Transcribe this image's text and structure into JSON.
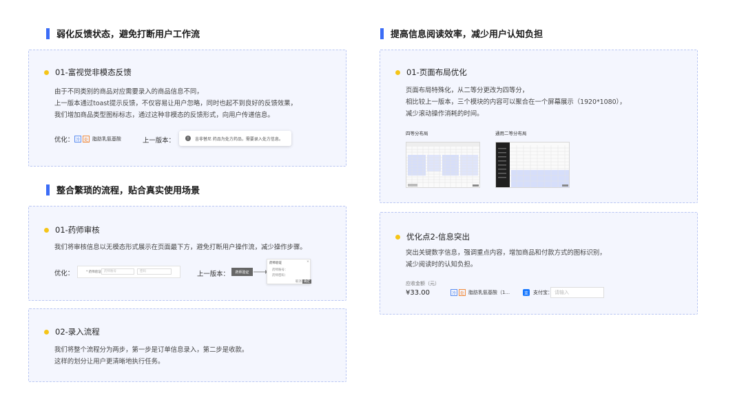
{
  "left": {
    "section1_title": "弱化反馈状态，避免打断用户工作流",
    "card1": {
      "title": "01-富视觉非模态反馈",
      "lines": [
        "由于不同类别的商品对应需要录入的商品信息不同，",
        "上一版本通过toast提示反馈，不仅容易让用户忽略，同时也起不到良好的反馈效果，",
        "我们增加商品类型图标标志，通过这种非模态的反馈形式，向用户传递信息。"
      ],
      "optimize_label": "优化：",
      "tag1": "冷",
      "tag2": "处",
      "drug_name": "脂肪乳氨基酸",
      "prev_label": "上一版本：",
      "toast_icon": "!",
      "toast_text": "吉非替尼 药品为处方药品，需要录入处方信息。"
    },
    "section2_title": "整合繁琐的流程，贴合真实使用场景",
    "card2": {
      "title": "01-药师审核",
      "lines": [
        "我们将审核信息以无模态形式展示在页面最下方，避免打断用户操作流，减少操作步骤。"
      ],
      "optimize_label": "优化：",
      "mini_field_label": "* 药师验证：",
      "mini_field_ph1": "药师账号",
      "mini_field_ph2": "密码",
      "prev_label": "上一版本：",
      "dark_btn": "药师验证",
      "dialog_title": "药师验证",
      "dialog_row1": "药师账号：",
      "dialog_row2": "药师密码：",
      "dialog_btn_cancel": "取消",
      "dialog_btn_ok": "确定"
    },
    "card3": {
      "title": "02-录入流程",
      "lines": [
        "我们将整个流程分为两步，第一步是订单信息录入，第二步是收款。",
        "这样的划分让用户更清晰地执行任务。"
      ]
    }
  },
  "right": {
    "section_title": "提高信息阅读效率，减少用户认知负担",
    "card1": {
      "title": "01-页面布局优化",
      "lines": [
        "页面布局特殊化，从二等分更改为四等分，",
        "相比较上一版本，三个模块的内容可以聚合在一个屏幕展示（1920*1080），",
        "减少滚动操作消耗的时间。"
      ],
      "caption_left": "四等分布局",
      "caption_right": "通用二等分布局"
    },
    "card2": {
      "title": "优化点2-信息突出",
      "lines": [
        "突出关键数字信息，强调重点内容，增加商品和付款方式的图标识别，",
        "减少阅读时的认知负担。"
      ],
      "amount_label": "应收金额（元）",
      "amount": "¥33.00",
      "tag1": "冷",
      "tag2": "处",
      "drug_name": "脂肪乳氨基酸（1...",
      "alipay_icon": "支",
      "pay_label": "支付宝：",
      "pay_placeholder": "请输入"
    }
  },
  "colors": {
    "accent": "#3b6cf6",
    "dot": "#f5c518",
    "card_bg": "#f4f6fe",
    "card_border": "#b9c6f3"
  }
}
